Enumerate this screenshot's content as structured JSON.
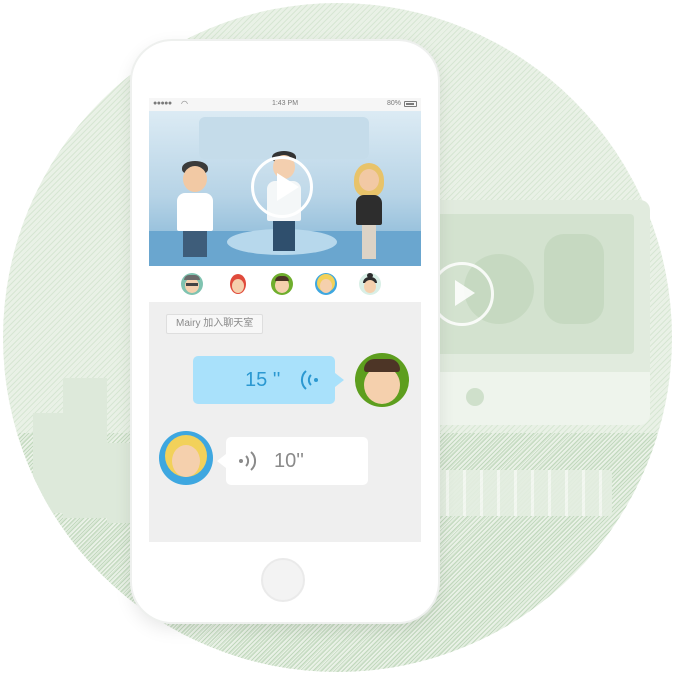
{
  "status_bar": {
    "carrier": "●●●●●",
    "time": "1:43 PM",
    "battery": "80%"
  },
  "video": {
    "play_icon": "play-icon"
  },
  "participants": [
    {
      "icon": "avatar-glasses-man"
    },
    {
      "icon": "avatar-red-hair"
    },
    {
      "icon": "avatar-green-bg-man"
    },
    {
      "icon": "avatar-blonde-girl"
    },
    {
      "icon": "avatar-bun-girl"
    }
  ],
  "chat": {
    "system_message": "Mairy 加入聊天室",
    "messages": [
      {
        "side": "right",
        "duration": "15 ''",
        "icon": "voice-wave-icon"
      },
      {
        "side": "left",
        "duration": "10''",
        "icon": "voice-wave-icon"
      }
    ]
  },
  "colors": {
    "outgoing_bubble": "#a9e1fb",
    "outgoing_text": "#2b98d1",
    "incoming_bubble": "#ffffff",
    "circle_bg": "#e9f1e6"
  }
}
